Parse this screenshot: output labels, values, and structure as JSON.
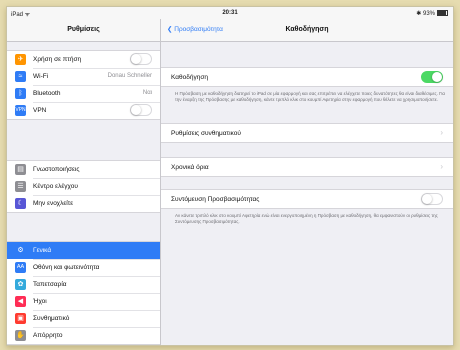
{
  "status": {
    "device": "iPad",
    "wifi_icon": "wifi-icon",
    "time": "20:31",
    "battery": "93%"
  },
  "sidebar": {
    "title": "Ρυθμίσεις",
    "items": [
      {
        "label": "Χρήση σε πτήση",
        "icon": "airplane-icon",
        "color": "#ff9500",
        "glyph": "✈",
        "toggle": false
      },
      {
        "label": "Wi-Fi",
        "icon": "wifi-icon",
        "color": "#2f7cf6",
        "glyph": "≈",
        "value": "Donau Schneller"
      },
      {
        "label": "Bluetooth",
        "icon": "bluetooth-icon",
        "color": "#2f7cf6",
        "glyph": "ᛒ",
        "value": "Ναι"
      },
      {
        "label": "VPN",
        "icon": "vpn-icon",
        "color": "#2f7cf6",
        "glyph": "V",
        "toggle": false
      },
      {
        "label": "Γνωστοποιήσεις",
        "icon": "notifications-icon",
        "color": "#8e8e93",
        "glyph": "▤"
      },
      {
        "label": "Κέντρο ελέγχου",
        "icon": "control-center-icon",
        "color": "#8e8e93",
        "glyph": "☰"
      },
      {
        "label": "Μην ενοχλείτε",
        "icon": "do-not-disturb-icon",
        "color": "#5856d6",
        "glyph": "☾"
      },
      {
        "label": "Γενικά",
        "icon": "gear-icon",
        "color": "#8e8e93",
        "glyph": "⚙",
        "selected": true
      },
      {
        "label": "Οθόνη και φωτεινότητα",
        "icon": "display-icon",
        "color": "#2f7cf6",
        "glyph": "A"
      },
      {
        "label": "Ταπετσαρία",
        "icon": "wallpaper-icon",
        "color": "#34aadc",
        "glyph": "✿"
      },
      {
        "label": "Ήχοι",
        "icon": "sounds-icon",
        "color": "#ff2d55",
        "glyph": "◀"
      },
      {
        "label": "Συνθηματικό",
        "icon": "passcode-icon",
        "color": "#ff3b30",
        "glyph": "▣"
      },
      {
        "label": "Απόρρητο",
        "icon": "privacy-icon",
        "color": "#8e8e93",
        "glyph": "✋"
      }
    ]
  },
  "main": {
    "back_label": "Προσβασιμότητα",
    "title": "Καθοδήγηση",
    "guided_access_label": "Καθοδήγηση",
    "guided_access_on": true,
    "guided_access_note": "Η Πρόσβαση με καθοδήγηση διατηρεί το iPad σε μία εφαρμογή και σας επιτρέπει να ελέγχετε ποιες δυνατότητες θα είναι διαθέσιμες. Για την έναρξη της Πρόσβασης με καθοδήγηση, κάντε τριπλό κλικ στο κουμπί Αφετηρία στην εφαρμογή που θέλετε να χρησιμοποιήσετε.",
    "passcode_settings_label": "Ρυθμίσεις συνθηματικού",
    "time_limits_label": "Χρονικά όρια",
    "shortcut_label": "Συντόμευση Προσβασιμότητας",
    "shortcut_on": false,
    "shortcut_note": "Αν κάνετε τριπλό κλικ στο κουμπί Αφετηρία ενώ είναι ενεργοποιημένη η Πρόσβαση με καθοδήγηση, θα εμφανιστούν οι ρυθμίσεις της Συντόμευσης Προσβασιμότητας.",
    "chevron_glyph": "›"
  },
  "colors": {
    "accent": "#2f7cf6",
    "toggle_on": "#4cd964"
  }
}
